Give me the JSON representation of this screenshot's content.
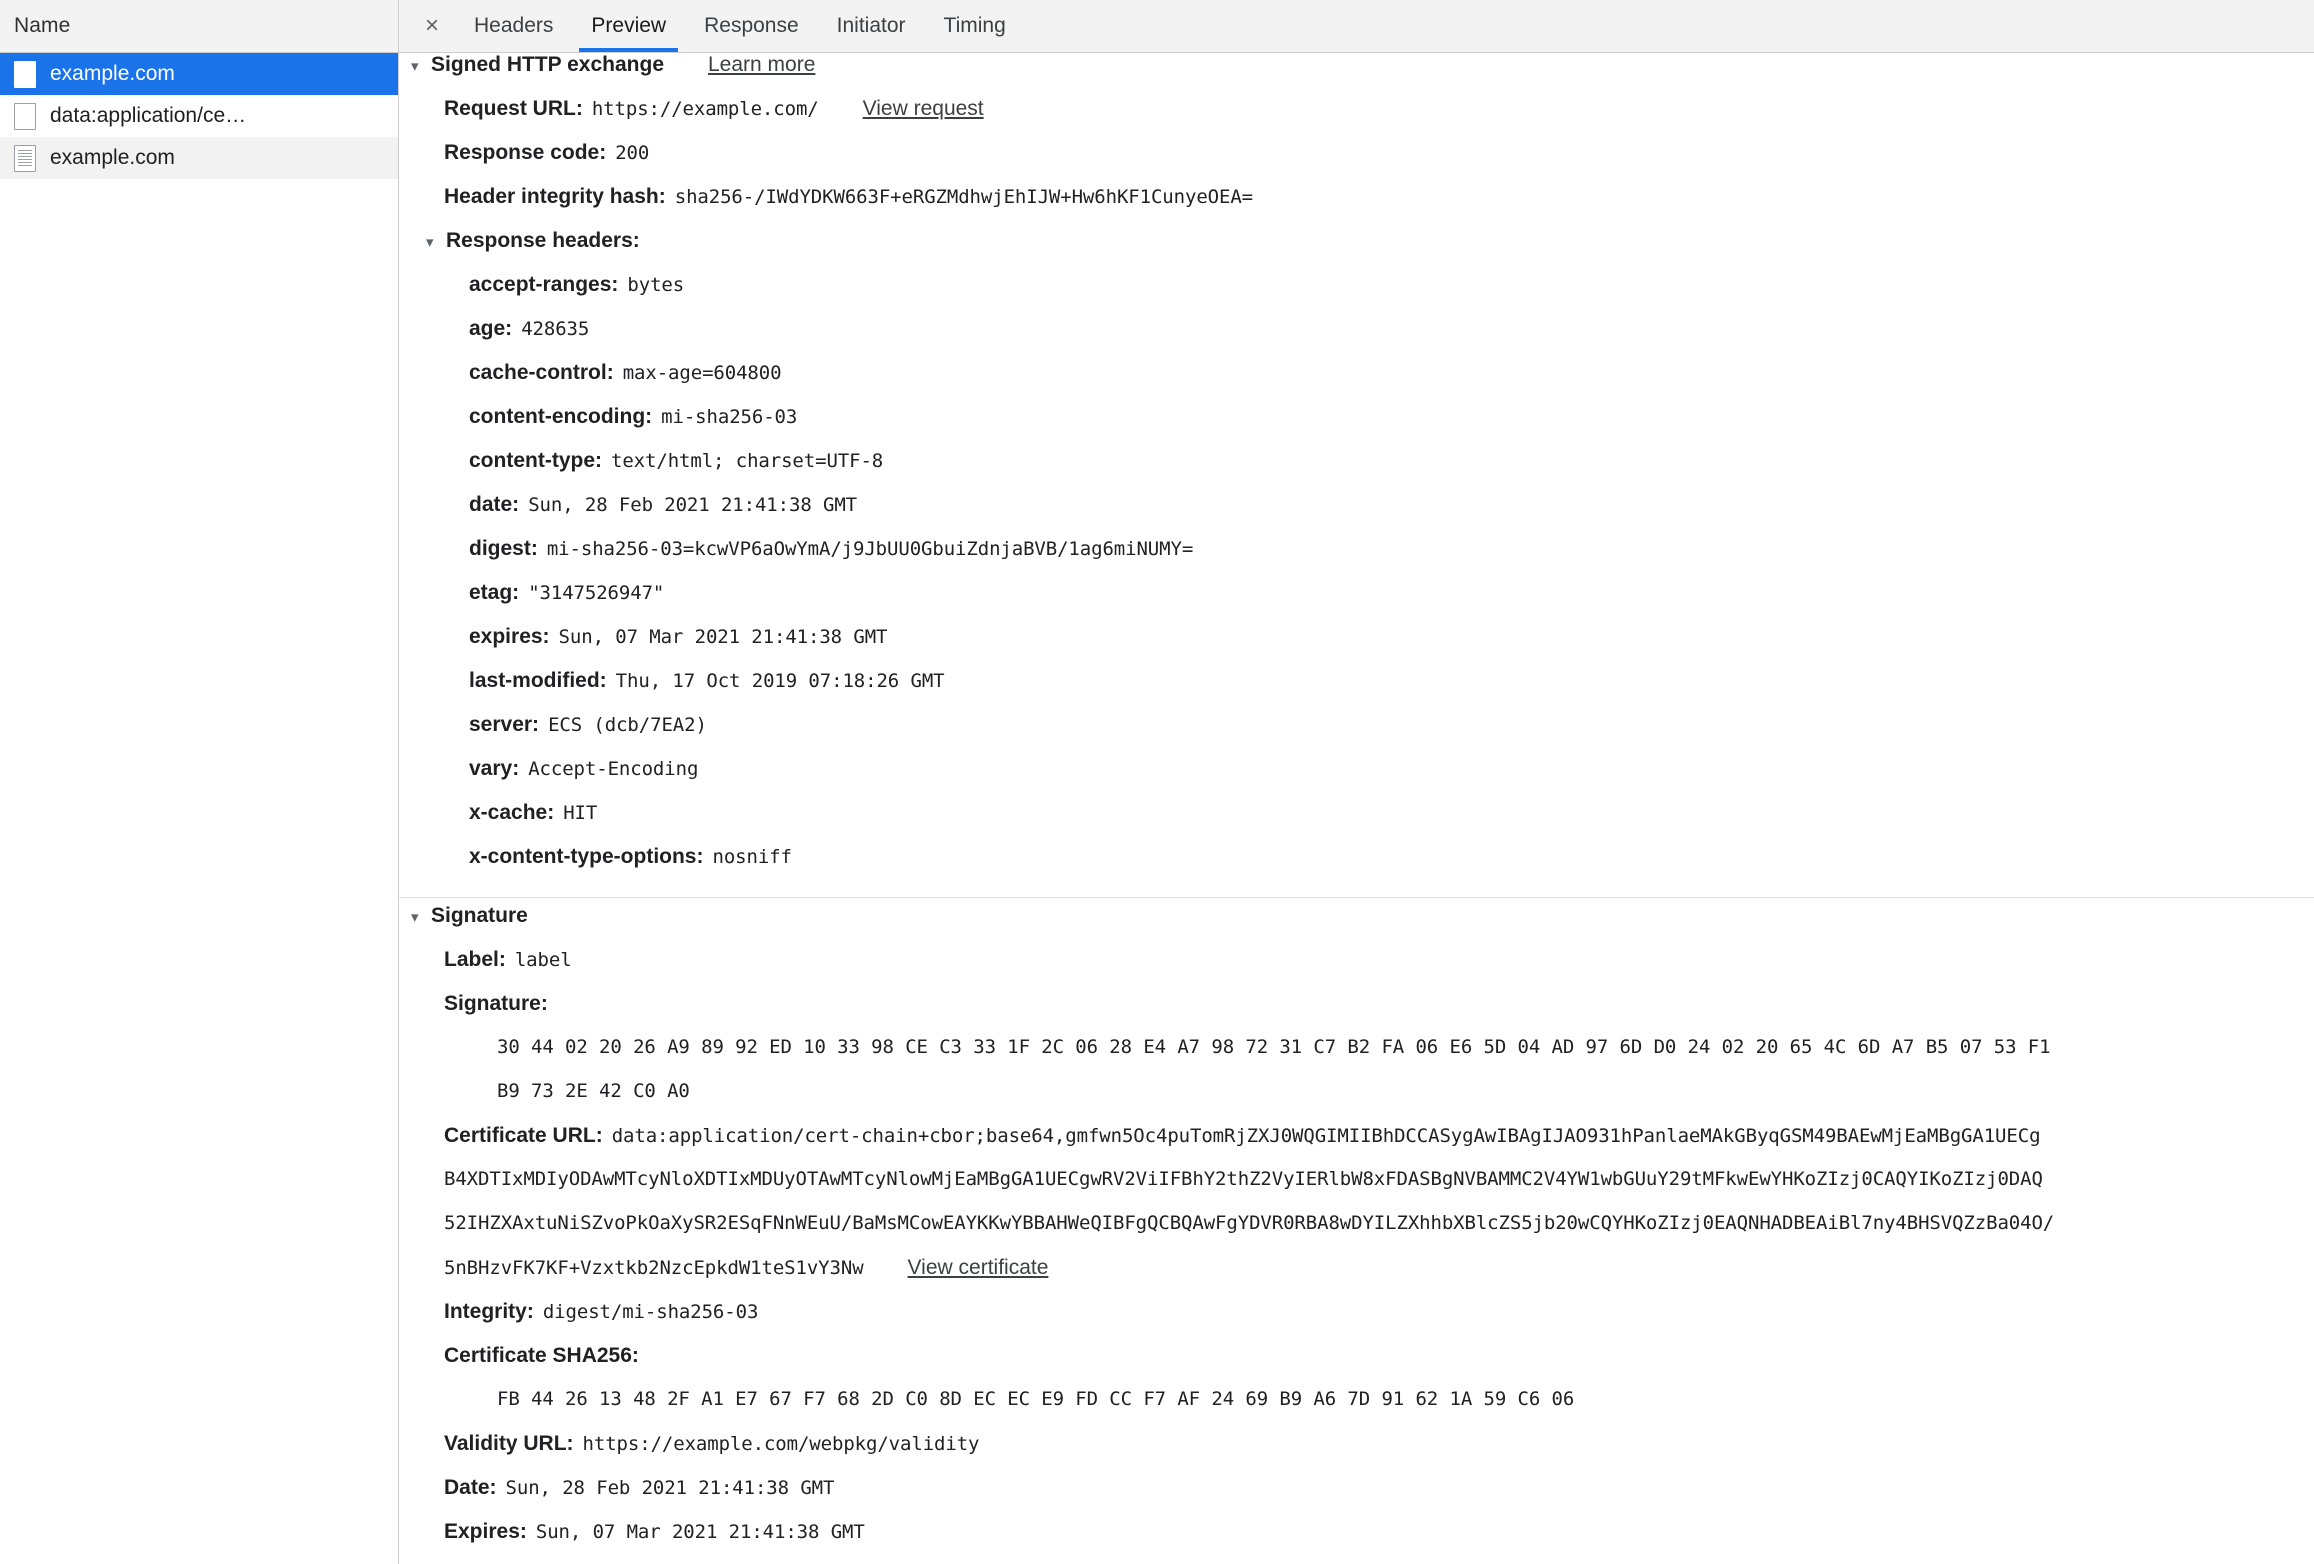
{
  "left_panel": {
    "header": "Name",
    "rows": [
      {
        "label": "example.com",
        "icon": "page-icon",
        "selected": true
      },
      {
        "label": "data:application/ce…",
        "icon": "page-icon",
        "selected": false
      },
      {
        "label": "example.com",
        "icon": "document-icon",
        "selected": false
      }
    ]
  },
  "tabbar": {
    "close_icon": "×",
    "tabs": [
      {
        "label": "Headers",
        "active": false
      },
      {
        "label": "Preview",
        "active": true
      },
      {
        "label": "Response",
        "active": false
      },
      {
        "label": "Initiator",
        "active": false
      },
      {
        "label": "Timing",
        "active": false
      }
    ]
  },
  "sxg": {
    "section_title": "Signed HTTP exchange",
    "learn_more": "Learn more",
    "request_url_key": "Request URL:",
    "request_url_value": "https://example.com/",
    "view_request": "View request",
    "response_code_key": "Response code:",
    "response_code_value": "200",
    "header_integrity_key": "Header integrity hash:",
    "header_integrity_value": "sha256-/IWdYDKW663F+eRGZMdhwjEhIJW+Hw6hKF1CunyeOEA=",
    "response_headers_title": "Response headers:",
    "response_headers": [
      {
        "name": "accept-ranges:",
        "value": "bytes"
      },
      {
        "name": "age:",
        "value": "428635"
      },
      {
        "name": "cache-control:",
        "value": "max-age=604800"
      },
      {
        "name": "content-encoding:",
        "value": "mi-sha256-03"
      },
      {
        "name": "content-type:",
        "value": "text/html; charset=UTF-8"
      },
      {
        "name": "date:",
        "value": "Sun, 28 Feb 2021 21:41:38 GMT"
      },
      {
        "name": "digest:",
        "value": "mi-sha256-03=kcwVP6aOwYmA/j9JbUU0GbuiZdnjaBVB/1ag6miNUMY="
      },
      {
        "name": "etag:",
        "value": "\"3147526947\""
      },
      {
        "name": "expires:",
        "value": "Sun, 07 Mar 2021 21:41:38 GMT"
      },
      {
        "name": "last-modified:",
        "value": "Thu, 17 Oct 2019 07:18:26 GMT"
      },
      {
        "name": "server:",
        "value": "ECS (dcb/7EA2)"
      },
      {
        "name": "vary:",
        "value": "Accept-Encoding"
      },
      {
        "name": "x-cache:",
        "value": "HIT"
      },
      {
        "name": "x-content-type-options:",
        "value": "nosniff"
      }
    ]
  },
  "signature": {
    "section_title": "Signature",
    "label_key": "Label:",
    "label_value": "label",
    "signature_key": "Signature:",
    "signature_bytes_line1": "30 44 02 20 26 A9 89 92 ED 10 33 98 CE C3 33 1F 2C 06 28 E4 A7 98 72 31 C7 B2 FA 06 E6 5D 04 AD 97 6D D0 24 02 20 65 4C 6D A7 B5 07 53 F1",
    "signature_bytes_line2": "B9 73 2E 42 C0 A0",
    "certificate_url_key": "Certificate URL:",
    "certificate_url_line1": "data:application/cert-chain+cbor;base64,gmfwn5Oc4puTomRjZXJ0WQGIMIIBhDCCASygAwIBAgIJAO931hPanlaeMAkGByqGSM49BAEwMjEaMBgGA1UECg",
    "certificate_url_line2": "B4XDTIxMDIyODAwMTcyNloXDTIxMDUyOTAwMTcyNlowMjEaMBgGA1UECgwRV2ViIFBhY2thZ2VyIERlbW8xFDASBgNVBAMMC2V4YW1wbGUuY29tMFkwEwYHKoZIzj0CAQYIKoZIzj0DAQ",
    "certificate_url_line3": "52IHZXAxtuNiSZvoPkOaXySR2ESqFNnWEuU/BaMsMCowEAYKKwYBBAHWeQIBFgQCBQAwFgYDVR0RBA8wDYILZXhhbXBlcZS5jb20wCQYHKoZIzj0EAQNHADBEAiBl7ny4BHSVQZzBa04O/",
    "certificate_url_line4": "5nBHzvFK7KF+Vzxtkb2NzcEpkdW1teS1vY3Nw",
    "view_certificate": "View certificate",
    "integrity_key": "Integrity:",
    "integrity_value": "digest/mi-sha256-03",
    "cert_sha256_key": "Certificate SHA256:",
    "cert_sha256_bytes": "FB 44 26 13 48 2F A1 E7 67 F7 68 2D C0 8D EC EC E9 FD CC F7 AF 24 69 B9 A6 7D 91 62 1A 59 C6 06",
    "validity_url_key": "Validity URL:",
    "validity_url_value": "https://example.com/webpkg/validity",
    "date_key": "Date:",
    "date_value": "Sun, 28 Feb 2021 21:41:38 GMT",
    "expires_key": "Expires:",
    "expires_value": "Sun, 07 Mar 2021 21:41:38 GMT"
  },
  "colors": {
    "accent": "#1a73e8",
    "selected_row": "#1a73e8",
    "header_bg": "#f3f3f3",
    "text": "#202124"
  }
}
